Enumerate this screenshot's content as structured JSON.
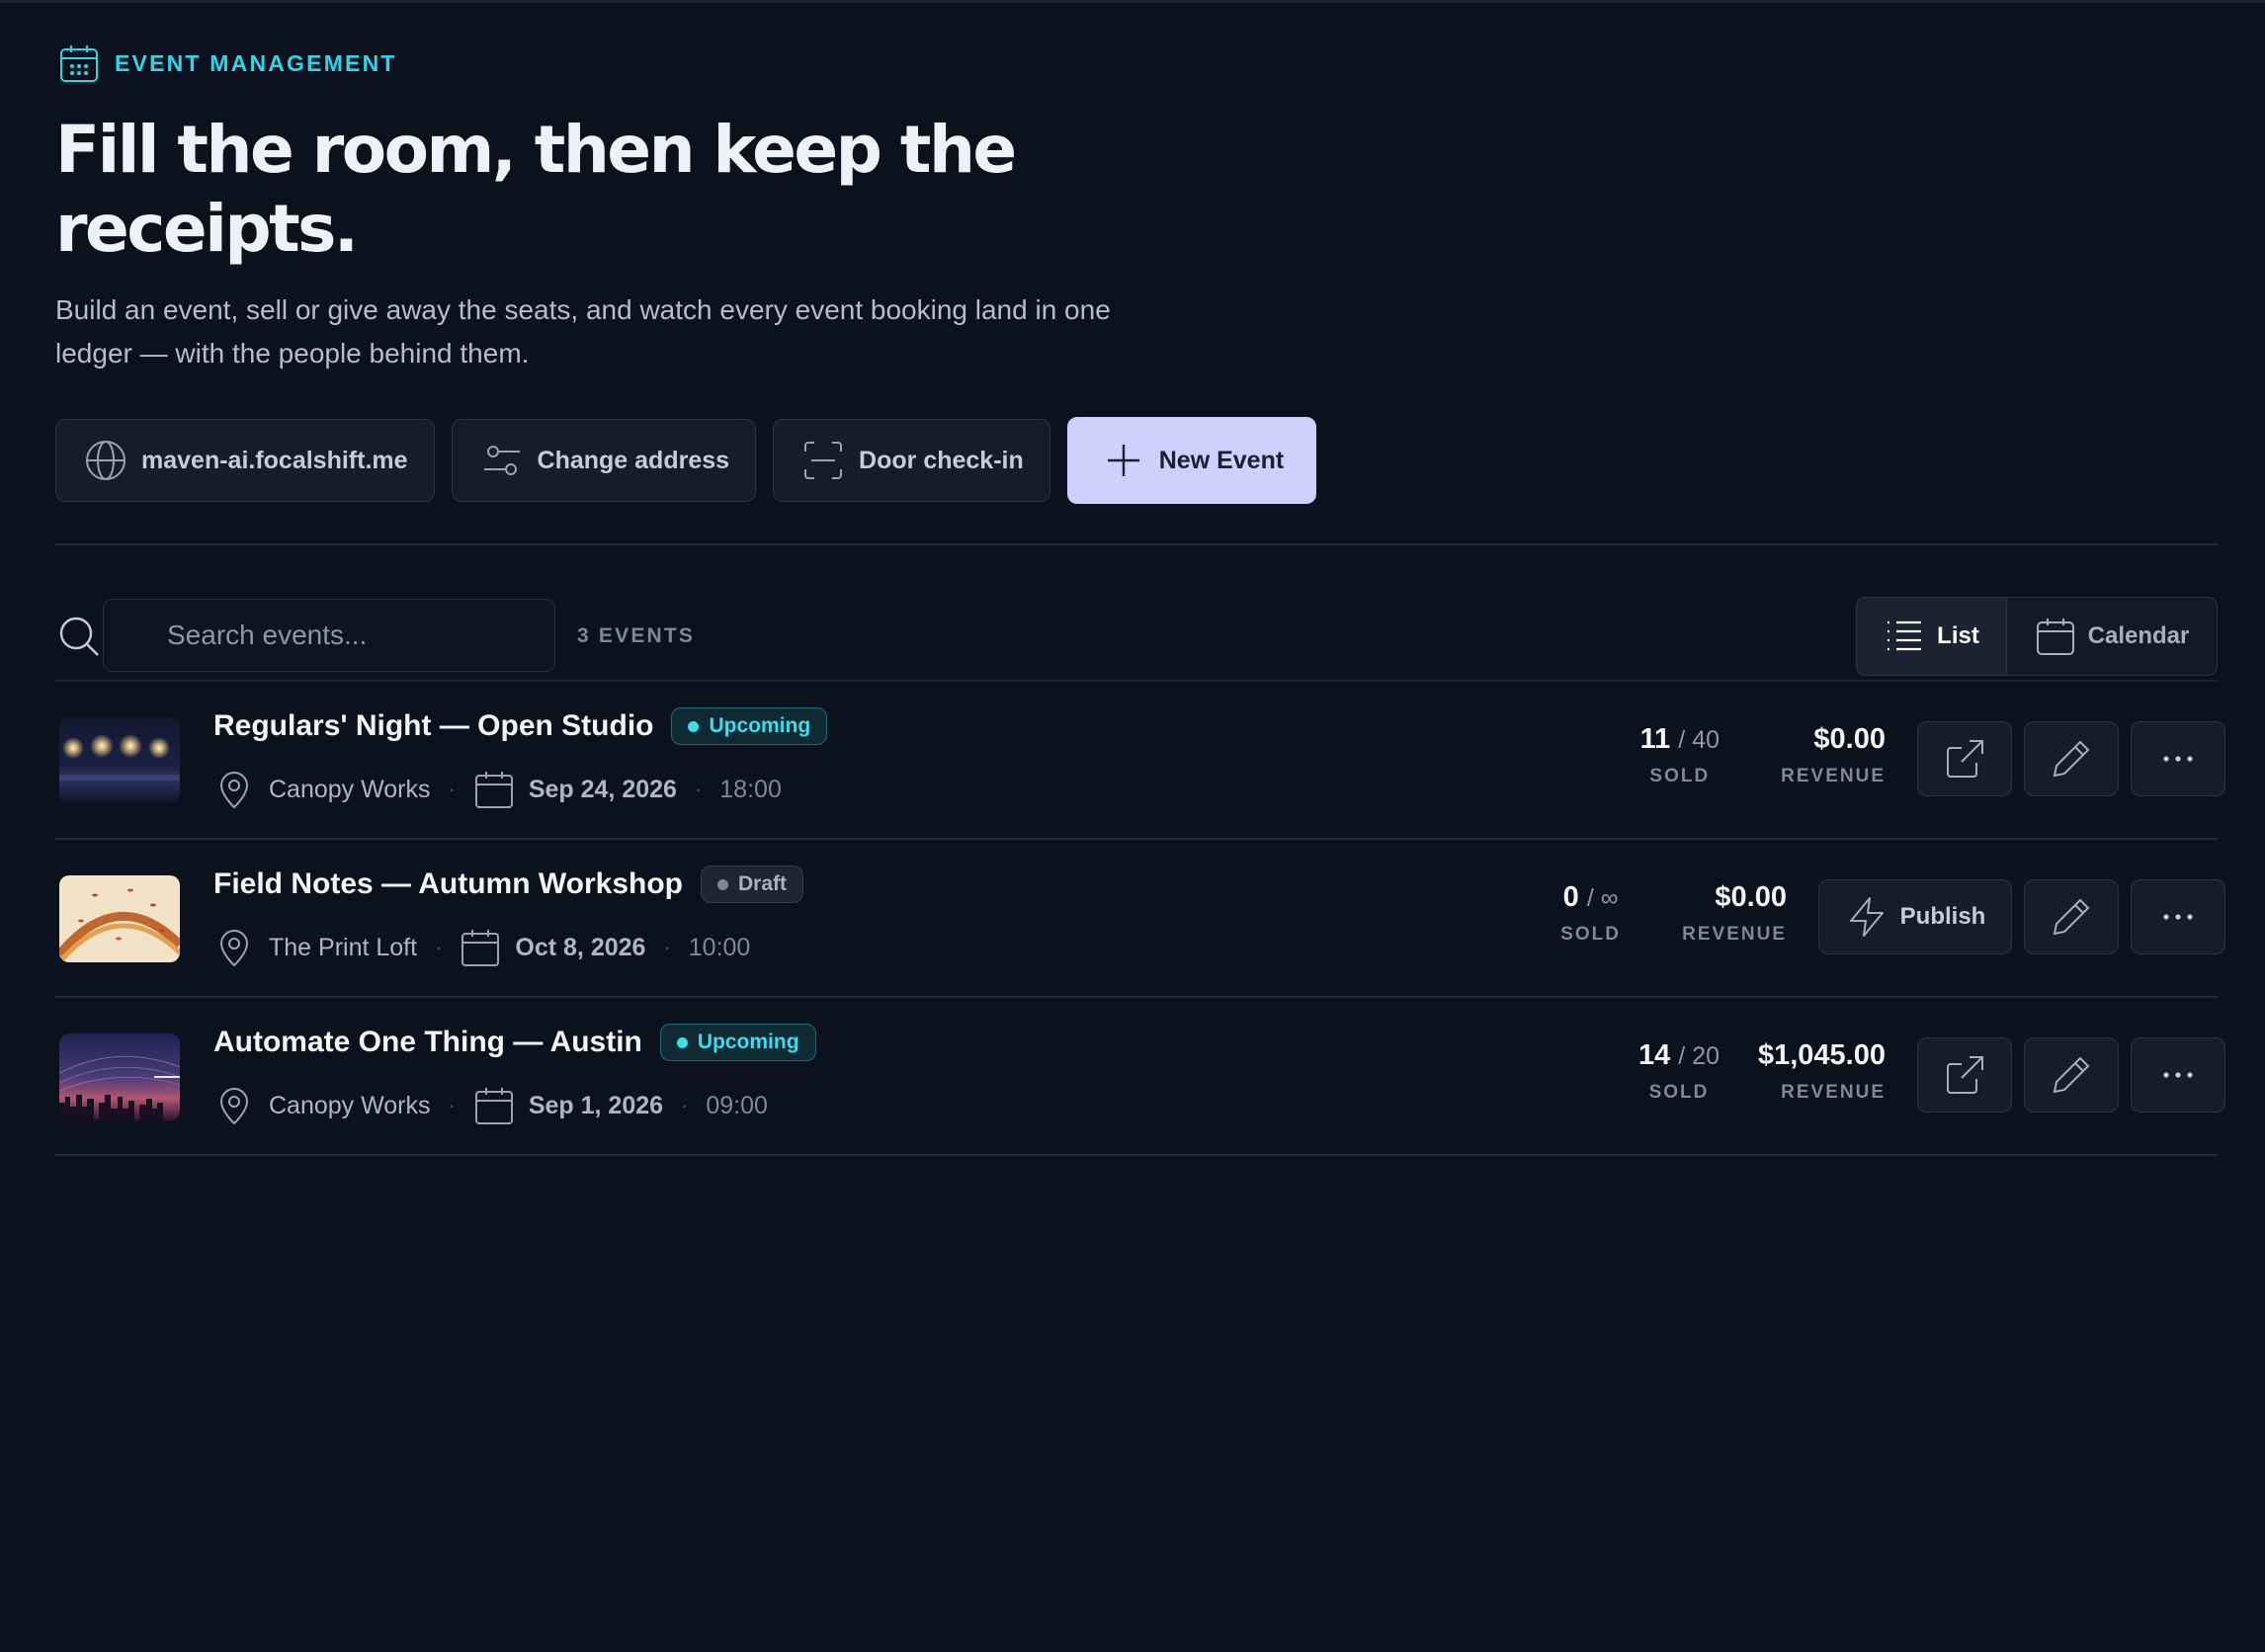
{
  "header": {
    "eyebrow": "EVENT MANAGEMENT",
    "headline": "Fill the room, then keep the receipts.",
    "subtitle": "Build an event, sell or give away the seats, and watch every event booking land in one ledger — with the people behind them."
  },
  "actions": {
    "domain_label": "maven-ai.focalshift.me",
    "change_address_label": "Change address",
    "door_checkin_label": "Door check-in",
    "new_event_label": "New Event"
  },
  "toolbar": {
    "search_placeholder": "Search events...",
    "event_count": "3 EVENTS",
    "view_list_label": "List",
    "view_calendar_label": "Calendar",
    "active_view": "List"
  },
  "events": [
    {
      "title": "Regulars' Night — Open Studio",
      "status": "Upcoming",
      "venue": "Canopy Works",
      "date": "Sep 24, 2026",
      "time": "18:00",
      "sold": "11",
      "capacity": "/ 40",
      "sold_label": "SOLD",
      "revenue": "$0.00",
      "revenue_label": "REVENUE",
      "thumbnail": "string-lights-stage"
    },
    {
      "title": "Field Notes — Autumn Workshop",
      "status": "Draft",
      "venue": "The Print Loft",
      "date": "Oct 8, 2026",
      "time": "10:00",
      "sold": "0",
      "capacity": "/ ∞",
      "sold_label": "SOLD",
      "revenue": "$0.00",
      "revenue_label": "REVENUE",
      "publish_label": "Publish",
      "thumbnail": "autumn-arc-leaves"
    },
    {
      "title": "Automate One Thing — Austin",
      "status": "Upcoming",
      "venue": "Canopy Works",
      "date": "Sep 1, 2026",
      "time": "09:00",
      "sold": "14",
      "capacity": "/ 20",
      "sold_label": "SOLD",
      "revenue": "$1,045.00",
      "revenue_label": "REVENUE",
      "thumbnail": "city-skyline-dusk"
    }
  ],
  "colors": {
    "background": "#0b111d",
    "accent_cyan": "#2fd4e6",
    "primary_button": "#cfd0fb",
    "upcoming_badge": "#3fdced",
    "draft_badge": "#aab2c1"
  }
}
